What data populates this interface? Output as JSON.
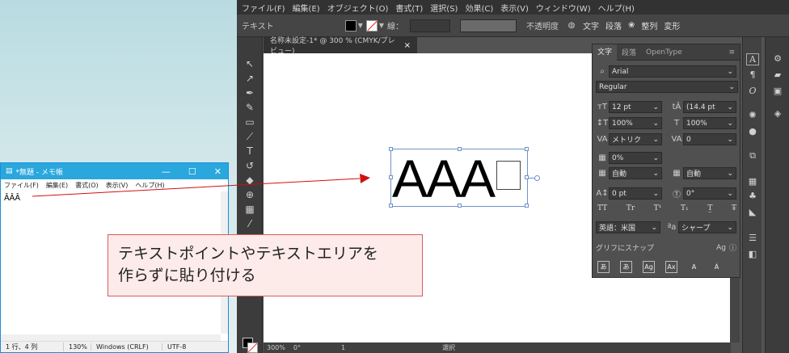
{
  "illustrator": {
    "menu": [
      "ファイル(F)",
      "編集(E)",
      "オブジェクト(O)",
      "書式(T)",
      "選択(S)",
      "効果(C)",
      "表示(V)",
      "ウィンドウ(W)",
      "ヘルプ(H)"
    ],
    "control": {
      "mode_label": "テキスト",
      "stroke_label": "線：",
      "opacity_label": "不透明度",
      "char_label": "文字",
      "para_label": "段落",
      "align_label": "整列",
      "transform_label": "変形"
    },
    "doc_tab": "名称未設定-1* @ 300 % (CMYK/プレビュー)",
    "doc_tab_close": "×",
    "canvas_text": "AAA",
    "status": {
      "zoom": "300%",
      "rotation": "0°",
      "page": "1",
      "mode": "選択"
    },
    "panel": {
      "tabs": [
        "文字",
        "段落",
        "OpenType"
      ],
      "font": "Arial",
      "style": "Regular",
      "size": "12 pt",
      "leading": "(14.4 pt",
      "vscale": "100%",
      "hscale": "100%",
      "kerning": "メトリク",
      "tracking": "0",
      "tsume": "0%",
      "aki_left": "自動",
      "aki_right": "自動",
      "baseline": "0 pt",
      "rotation": "0°",
      "language": "英語：米国",
      "aa": "シャープ",
      "snap_label": "グリフにスナップ"
    }
  },
  "notepad": {
    "title": "*無題 - メモ帳",
    "menu": [
      "ファイル(F)",
      "編集(E)",
      "書式(O)",
      "表示(V)",
      "ヘルプ(H)"
    ],
    "content": "ÂÂÂ",
    "status": [
      "1 行、4 列",
      "130%",
      "Windows (CRLF)",
      "UTF-8"
    ],
    "controls": [
      "—",
      "☐",
      "✕"
    ]
  },
  "callout": {
    "line1": "テキストポイントやテキストエリアを",
    "line2": "作らずに貼り付ける"
  },
  "colors": {
    "ai_bg": "#535353",
    "notepad_title": "#2aa7dd",
    "callout_border": "#d06060",
    "callout_bg": "#fcebe8",
    "arrow": "#d01010"
  }
}
